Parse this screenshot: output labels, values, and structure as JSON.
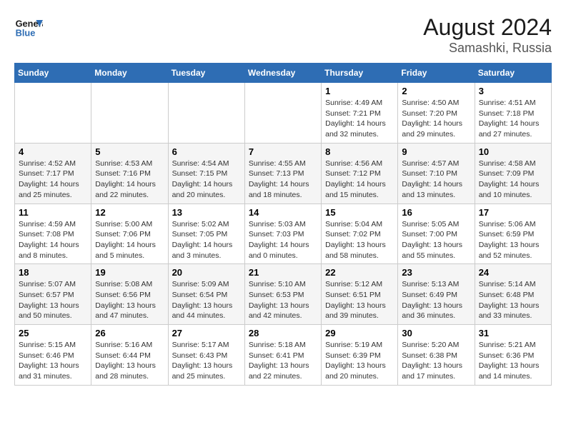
{
  "logo": {
    "line1": "General",
    "line2": "Blue"
  },
  "title": "August 2024",
  "subtitle": "Samashki, Russia",
  "days_of_week": [
    "Sunday",
    "Monday",
    "Tuesday",
    "Wednesday",
    "Thursday",
    "Friday",
    "Saturday"
  ],
  "weeks": [
    [
      {
        "day": "",
        "info": ""
      },
      {
        "day": "",
        "info": ""
      },
      {
        "day": "",
        "info": ""
      },
      {
        "day": "",
        "info": ""
      },
      {
        "day": "1",
        "info": "Sunrise: 4:49 AM\nSunset: 7:21 PM\nDaylight: 14 hours\nand 32 minutes."
      },
      {
        "day": "2",
        "info": "Sunrise: 4:50 AM\nSunset: 7:20 PM\nDaylight: 14 hours\nand 29 minutes."
      },
      {
        "day": "3",
        "info": "Sunrise: 4:51 AM\nSunset: 7:18 PM\nDaylight: 14 hours\nand 27 minutes."
      }
    ],
    [
      {
        "day": "4",
        "info": "Sunrise: 4:52 AM\nSunset: 7:17 PM\nDaylight: 14 hours\nand 25 minutes."
      },
      {
        "day": "5",
        "info": "Sunrise: 4:53 AM\nSunset: 7:16 PM\nDaylight: 14 hours\nand 22 minutes."
      },
      {
        "day": "6",
        "info": "Sunrise: 4:54 AM\nSunset: 7:15 PM\nDaylight: 14 hours\nand 20 minutes."
      },
      {
        "day": "7",
        "info": "Sunrise: 4:55 AM\nSunset: 7:13 PM\nDaylight: 14 hours\nand 18 minutes."
      },
      {
        "day": "8",
        "info": "Sunrise: 4:56 AM\nSunset: 7:12 PM\nDaylight: 14 hours\nand 15 minutes."
      },
      {
        "day": "9",
        "info": "Sunrise: 4:57 AM\nSunset: 7:10 PM\nDaylight: 14 hours\nand 13 minutes."
      },
      {
        "day": "10",
        "info": "Sunrise: 4:58 AM\nSunset: 7:09 PM\nDaylight: 14 hours\nand 10 minutes."
      }
    ],
    [
      {
        "day": "11",
        "info": "Sunrise: 4:59 AM\nSunset: 7:08 PM\nDaylight: 14 hours\nand 8 minutes."
      },
      {
        "day": "12",
        "info": "Sunrise: 5:00 AM\nSunset: 7:06 PM\nDaylight: 14 hours\nand 5 minutes."
      },
      {
        "day": "13",
        "info": "Sunrise: 5:02 AM\nSunset: 7:05 PM\nDaylight: 14 hours\nand 3 minutes."
      },
      {
        "day": "14",
        "info": "Sunrise: 5:03 AM\nSunset: 7:03 PM\nDaylight: 14 hours\nand 0 minutes."
      },
      {
        "day": "15",
        "info": "Sunrise: 5:04 AM\nSunset: 7:02 PM\nDaylight: 13 hours\nand 58 minutes."
      },
      {
        "day": "16",
        "info": "Sunrise: 5:05 AM\nSunset: 7:00 PM\nDaylight: 13 hours\nand 55 minutes."
      },
      {
        "day": "17",
        "info": "Sunrise: 5:06 AM\nSunset: 6:59 PM\nDaylight: 13 hours\nand 52 minutes."
      }
    ],
    [
      {
        "day": "18",
        "info": "Sunrise: 5:07 AM\nSunset: 6:57 PM\nDaylight: 13 hours\nand 50 minutes."
      },
      {
        "day": "19",
        "info": "Sunrise: 5:08 AM\nSunset: 6:56 PM\nDaylight: 13 hours\nand 47 minutes."
      },
      {
        "day": "20",
        "info": "Sunrise: 5:09 AM\nSunset: 6:54 PM\nDaylight: 13 hours\nand 44 minutes."
      },
      {
        "day": "21",
        "info": "Sunrise: 5:10 AM\nSunset: 6:53 PM\nDaylight: 13 hours\nand 42 minutes."
      },
      {
        "day": "22",
        "info": "Sunrise: 5:12 AM\nSunset: 6:51 PM\nDaylight: 13 hours\nand 39 minutes."
      },
      {
        "day": "23",
        "info": "Sunrise: 5:13 AM\nSunset: 6:49 PM\nDaylight: 13 hours\nand 36 minutes."
      },
      {
        "day": "24",
        "info": "Sunrise: 5:14 AM\nSunset: 6:48 PM\nDaylight: 13 hours\nand 33 minutes."
      }
    ],
    [
      {
        "day": "25",
        "info": "Sunrise: 5:15 AM\nSunset: 6:46 PM\nDaylight: 13 hours\nand 31 minutes."
      },
      {
        "day": "26",
        "info": "Sunrise: 5:16 AM\nSunset: 6:44 PM\nDaylight: 13 hours\nand 28 minutes."
      },
      {
        "day": "27",
        "info": "Sunrise: 5:17 AM\nSunset: 6:43 PM\nDaylight: 13 hours\nand 25 minutes."
      },
      {
        "day": "28",
        "info": "Sunrise: 5:18 AM\nSunset: 6:41 PM\nDaylight: 13 hours\nand 22 minutes."
      },
      {
        "day": "29",
        "info": "Sunrise: 5:19 AM\nSunset: 6:39 PM\nDaylight: 13 hours\nand 20 minutes."
      },
      {
        "day": "30",
        "info": "Sunrise: 5:20 AM\nSunset: 6:38 PM\nDaylight: 13 hours\nand 17 minutes."
      },
      {
        "day": "31",
        "info": "Sunrise: 5:21 AM\nSunset: 6:36 PM\nDaylight: 13 hours\nand 14 minutes."
      }
    ]
  ]
}
